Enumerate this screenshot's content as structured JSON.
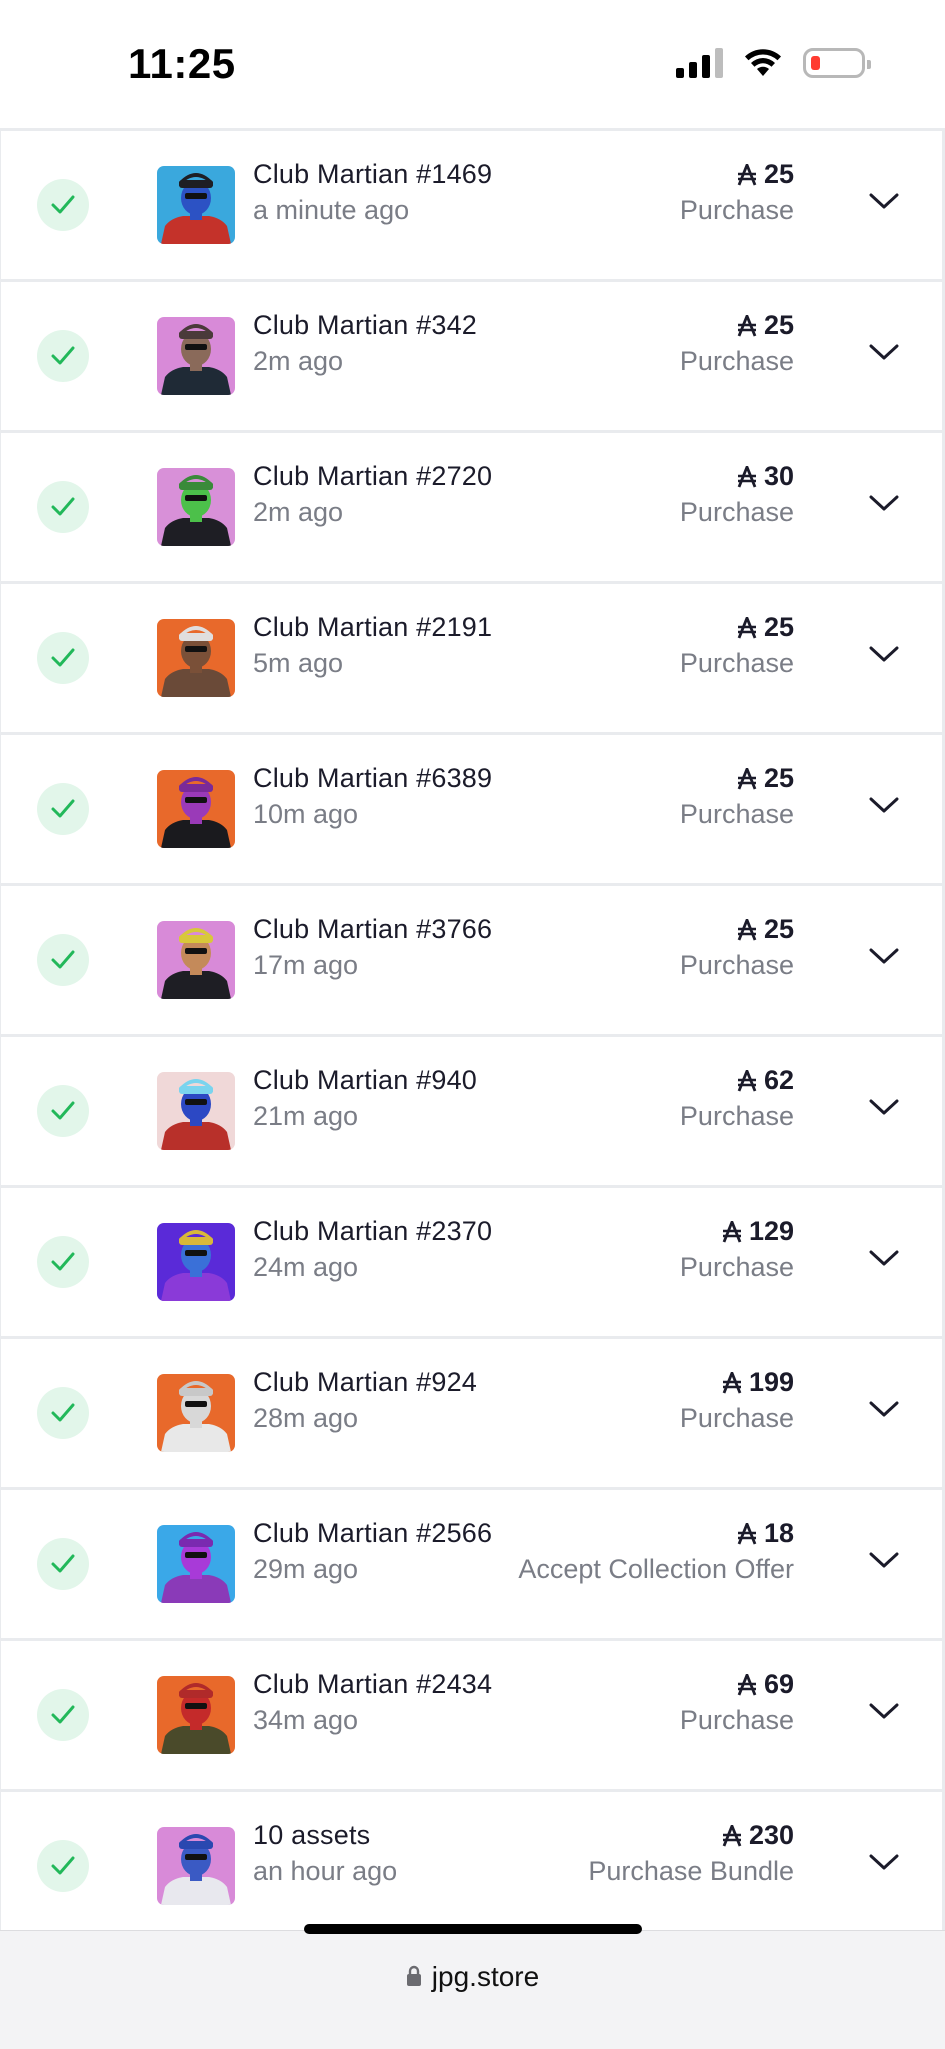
{
  "status_bar": {
    "time": "11:25"
  },
  "transactions": [
    {
      "title": "Club Martian #1469",
      "ago": "a minute ago",
      "price": "25",
      "kind": "Purchase",
      "bg": "#3aa8dd",
      "skin": "#2c52c4",
      "hat": "#1e1e24",
      "shirt": "#c4322a"
    },
    {
      "title": "Club Martian #342",
      "ago": "2m ago",
      "price": "25",
      "kind": "Purchase",
      "bg": "#d88ad8",
      "skin": "#8a6a5a",
      "hat": "#4a3a3a",
      "shirt": "#1f2a36"
    },
    {
      "title": "Club Martian #2720",
      "ago": "2m ago",
      "price": "30",
      "kind": "Purchase",
      "bg": "#d890d8",
      "skin": "#4cc04a",
      "hat": "#3a8a3a",
      "shirt": "#1e1e24"
    },
    {
      "title": "Club Martian #2191",
      "ago": "5m ago",
      "price": "25",
      "kind": "Purchase",
      "bg": "#e8692b",
      "skin": "#7a5038",
      "hat": "#e0dede",
      "shirt": "#6a4a38"
    },
    {
      "title": "Club Martian #6389",
      "ago": "10m ago",
      "price": "25",
      "kind": "Purchase",
      "bg": "#e8692b",
      "skin": "#9a3ab8",
      "hat": "#7a2a98",
      "shirt": "#1a1a1e"
    },
    {
      "title": "Club Martian #3766",
      "ago": "17m ago",
      "price": "25",
      "kind": "Purchase",
      "bg": "#d88ad8",
      "skin": "#c48a5a",
      "hat": "#d8c83a",
      "shirt": "#1e1e24"
    },
    {
      "title": "Club Martian #940",
      "ago": "21m ago",
      "price": "62",
      "kind": "Purchase",
      "bg": "#f0d8d8",
      "skin": "#2c48c4",
      "hat": "#7ad4ee",
      "shirt": "#b8302a"
    },
    {
      "title": "Club Martian #2370",
      "ago": "24m ago",
      "price": "129",
      "kind": "Purchase",
      "bg": "#5a2ad8",
      "skin": "#3a70d8",
      "hat": "#d8b83a",
      "shirt": "#8a3ad8"
    },
    {
      "title": "Club Martian #924",
      "ago": "28m ago",
      "price": "199",
      "kind": "Purchase",
      "bg": "#e8692b",
      "skin": "#d8d8d8",
      "hat": "#c8c8c8",
      "shirt": "#e8e8e8"
    },
    {
      "title": "Club Martian #2566",
      "ago": "29m ago",
      "price": "18",
      "kind": "Accept Collection Offer",
      "bg": "#3aa8e8",
      "skin": "#a83ad8",
      "hat": "#7a2ab0",
      "shirt": "#8a3ab8"
    },
    {
      "title": "Club Martian #2434",
      "ago": "34m ago",
      "price": "69",
      "kind": "Purchase",
      "bg": "#e8692b",
      "skin": "#c42a2a",
      "hat": "#b02a2a",
      "shirt": "#4a4a2a"
    },
    {
      "title": "10 assets",
      "ago": "an hour ago",
      "price": "230",
      "kind": "Purchase Bundle",
      "bg": "#d88ad8",
      "skin": "#3a5ac4",
      "hat": "#2a48b0",
      "shirt": "#e8e8ee"
    }
  ],
  "address_bar": {
    "domain": "jpg.store"
  },
  "colors": {
    "check_green": "#22b85a",
    "check_bg": "#e2f6ea",
    "muted_text": "#7a7d86"
  }
}
